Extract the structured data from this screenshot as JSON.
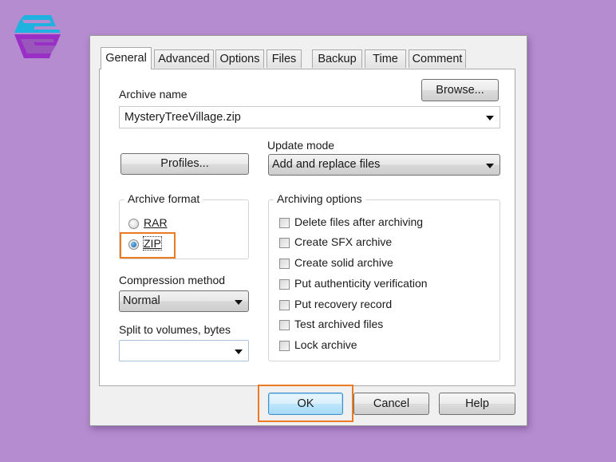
{
  "brand": {
    "logo_icon": "hexagon-e-logo-icon",
    "colors": {
      "background": "#b48ccf",
      "highlight": "#ec7a22",
      "logo_top": "#1fb2e0",
      "logo_bottom": "#9a2fc7"
    }
  },
  "tabs": [
    {
      "label": "General",
      "active": true
    },
    {
      "label": "Advanced",
      "active": false
    },
    {
      "label": "Options",
      "active": false
    },
    {
      "label": "Files",
      "active": false
    },
    {
      "label": "Backup",
      "active": false
    },
    {
      "label": "Time",
      "active": false
    },
    {
      "label": "Comment",
      "active": false
    }
  ],
  "general": {
    "archive_name_label": "Archive name",
    "browse_label": "Browse...",
    "archive_name_value": "MysteryTreeVillage.zip",
    "profiles_label": "Profiles...",
    "update_mode_label": "Update mode",
    "update_mode_value": "Add and replace files",
    "archive_format": {
      "title": "Archive format",
      "options": [
        {
          "label": "RAR",
          "checked": false
        },
        {
          "label": "ZIP",
          "checked": true
        }
      ]
    },
    "compression_method_label": "Compression method",
    "compression_method_value": "Normal",
    "split_label": "Split to volumes, bytes",
    "split_value": "",
    "archiving_options": {
      "title": "Archiving options",
      "items": [
        {
          "label": "Delete files after archiving",
          "checked": false
        },
        {
          "label": "Create SFX archive",
          "checked": false
        },
        {
          "label": "Create solid archive",
          "checked": false
        },
        {
          "label": "Put authenticity verification",
          "checked": false
        },
        {
          "label": "Put recovery record",
          "checked": false
        },
        {
          "label": "Test archived files",
          "checked": false
        },
        {
          "label": "Lock archive",
          "checked": false
        }
      ]
    }
  },
  "footer": {
    "ok_label": "OK",
    "cancel_label": "Cancel",
    "help_label": "Help"
  }
}
